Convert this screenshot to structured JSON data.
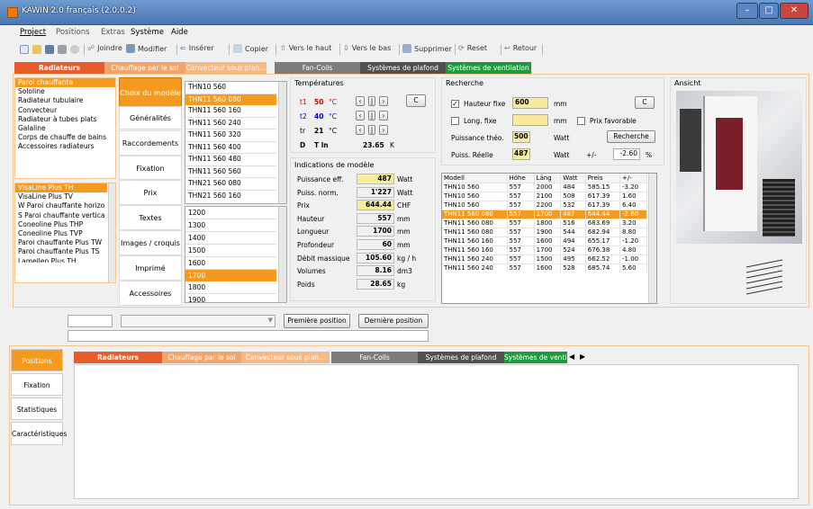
{
  "window": {
    "title": "KAWIN 2.0 français (2.0.0.2)"
  },
  "menu": [
    "Project",
    "Positions",
    "Extras",
    "Système",
    "Aide"
  ],
  "toolbar": {
    "join": "Joindre",
    "modify": "Modifier",
    "insert": "Insérer",
    "copy": "Copier",
    "up": "Vers le haut",
    "down": "Vers le bas",
    "delete": "Supprimer",
    "reset": "Reset",
    "back": "Retour"
  },
  "categories": [
    {
      "label": "Radiateurs",
      "color": "#e85b2a"
    },
    {
      "label": "Chauffage par le sol",
      "color": "#f1a56c"
    },
    {
      "label": "Convecteur sous plan...",
      "color": "#f4b984"
    },
    {
      "label": "Fan-Coils",
      "color": "#7c7c7c"
    },
    {
      "label": "Systèmes de plafond",
      "color": "#505050"
    },
    {
      "label": "Systèmes de ventilation",
      "color": "#1d9b3c"
    }
  ],
  "types": [
    "Paroi chauffante",
    "Sololine",
    "Radiateur tubulaire",
    "Convecteur",
    "Radiateur à tubes plats",
    "Galaline",
    "Corps de chauffe de bains",
    "Accessoires radiateurs"
  ],
  "models": [
    "VisaLine Plus TH",
    "VisaLine Plus TV",
    "W Paroi chauffante horizo",
    "S Paroi chauffante vertica",
    "Coneoline Plus THP",
    "Coneoline Plus TVP",
    "Paroi chauffante Plus TW",
    "Paroi chauffante Plus TS",
    "Lamellen Plus TH.."
  ],
  "nav": [
    "Choix du modèle",
    "Généralités",
    "Raccordements",
    "Fixation",
    "Prix",
    "Textes",
    "Images / croquis",
    "Imprimé",
    "Accessoires"
  ],
  "thn_list": [
    "THN10 560",
    "THN11 560 080",
    "THN11 560 160",
    "THN11 560 240",
    "THN11 560 320",
    "THN11 560 400",
    "THN11 560 480",
    "THN11 560 560",
    "THN21 560 080",
    "THN21 560 160"
  ],
  "len_list": [
    "1200",
    "1300",
    "1400",
    "1500",
    "1600",
    "1700",
    "1800",
    "1900"
  ],
  "temps": {
    "title": "Températures",
    "t1": {
      "label": "t1",
      "value": "50",
      "unit": "°C"
    },
    "t2": {
      "label": "t2",
      "value": "40",
      "unit": "°C"
    },
    "tr": {
      "label": "tr",
      "value": "21",
      "unit": "°C"
    },
    "d": {
      "label": "D",
      "sub": "T ln",
      "value": "23.65",
      "unit": "K"
    },
    "c_btn": "C"
  },
  "indications": {
    "title": "Indications de modèle",
    "rows": [
      {
        "label": "Puissance eff.",
        "value": "487",
        "unit": "Watt",
        "hl": true
      },
      {
        "label": "Puiss. norm.",
        "value": "1'227",
        "unit": "Watt",
        "hl": false
      },
      {
        "label": "Prix",
        "value": "644.44",
        "unit": "CHF",
        "hl": true
      },
      {
        "label": "Hauteur",
        "value": "557",
        "unit": "mm",
        "hl": false
      },
      {
        "label": "Longueur",
        "value": "1700",
        "unit": "mm",
        "hl": false
      },
      {
        "label": "Profondeur",
        "value": "60",
        "unit": "mm",
        "hl": false
      },
      {
        "label": "Débit massique",
        "value": "105.60",
        "unit": "kg / h",
        "hl": false
      },
      {
        "label": "Volumes",
        "value": "8.16",
        "unit": "dm3",
        "hl": false
      },
      {
        "label": "Poids",
        "value": "28.65",
        "unit": "kg",
        "hl": false
      }
    ]
  },
  "recherche": {
    "title": "Recherche",
    "hauteur": {
      "label": "Hauteur fixe",
      "value": "600",
      "unit": "mm"
    },
    "long": {
      "label": "Long. fixe",
      "value": "",
      "unit": "mm"
    },
    "prix_fav": "Prix favorable",
    "pth": {
      "label": "Puissance théo.",
      "value": "500",
      "unit": "Watt"
    },
    "preelle": {
      "label": "Puiss. Réelle",
      "value": "487",
      "unit": "Watt",
      "pm": "+/-",
      "pct": "-2.60",
      "pct_unit": "%"
    },
    "btn_c": "C",
    "btn_search": "Recherche"
  },
  "grid": {
    "headers": [
      "Modell",
      "Höhe",
      "Läng",
      "Watt",
      "Preis",
      "+/-"
    ],
    "rows": [
      [
        "THN10 560",
        "557",
        "2000",
        "484",
        "585.15",
        "-3.20"
      ],
      [
        "THN10 560",
        "557",
        "2100",
        "508",
        "617.39",
        "1.60"
      ],
      [
        "THN10 560",
        "557",
        "2200",
        "532",
        "617.39",
        "6.40"
      ],
      [
        "THN11 560 080",
        "557",
        "1700",
        "487",
        "644.44",
        "-2.60"
      ],
      [
        "THN11 560 080",
        "557",
        "1800",
        "516",
        "683.69",
        "3.20"
      ],
      [
        "THN11 560 080",
        "557",
        "1900",
        "544",
        "682.94",
        "8.80"
      ],
      [
        "THN11 560 160",
        "557",
        "1600",
        "494",
        "655.17",
        "-1.20"
      ],
      [
        "THN11 560 160",
        "557",
        "1700",
        "524",
        "676.38",
        "4.80"
      ],
      [
        "THN11 560 240",
        "557",
        "1500",
        "495",
        "662.52",
        "-1.00"
      ],
      [
        "THN11 560 240",
        "557",
        "1600",
        "528",
        "685.74",
        "5.60"
      ]
    ],
    "selected": 3
  },
  "ansicht": {
    "title": "Ansicht"
  },
  "positions": {
    "first": "Première position",
    "last": "Dernière position"
  },
  "bottom_tabs": [
    "Positions",
    "Fixation",
    "Statistiques",
    "Caractéristiques"
  ],
  "colors": {
    "accent": "#f39a1f",
    "highlight": "#f6ec9c",
    "titlebar": "#4a77b3"
  }
}
